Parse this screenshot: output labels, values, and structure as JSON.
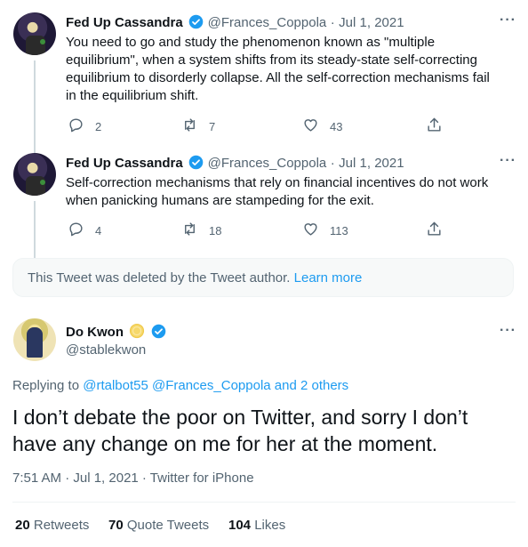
{
  "tweets": [
    {
      "name": "Fed Up Cassandra",
      "handle": "@Frances_Coppola",
      "date": "Jul 1, 2021",
      "text": "You need to go and study the phenomenon known as \"multiple equilibrium\", when a system shifts from its steady-state self-correcting equilibrium to disorderly collapse. All the self-correction mechanisms fail in the equilibrium shift.",
      "replies": "2",
      "retweets": "7",
      "likes": "43"
    },
    {
      "name": "Fed Up Cassandra",
      "handle": "@Frances_Coppola",
      "date": "Jul 1, 2021",
      "text": "Self-correction mechanisms that rely on financial incentives do not work when panicking humans are stampeding for the exit.",
      "replies": "4",
      "retweets": "18",
      "likes": "113"
    }
  ],
  "deleted_notice": {
    "text": "This Tweet was deleted by the Tweet author.",
    "link": "Learn more"
  },
  "main_tweet": {
    "name": "Do Kwon",
    "handle": "@stablekwon",
    "replying_label": "Replying to",
    "replying_to": "@rtalbot55 @Frances_Coppola and 2 others",
    "text": "I don’t debate the poor on Twitter, and sorry I don’t have any change on me for her at the moment.",
    "timestamp": "7:51 AM · Jul 1, 2021 · Twitter for iPhone",
    "stats": {
      "retweets_count": "20",
      "retweets_label": "Retweets",
      "quotes_count": "70",
      "quotes_label": "Quote Tweets",
      "likes_count": "104",
      "likes_label": "Likes"
    }
  },
  "colors": {
    "accent": "#1d9bf0",
    "muted": "#536471",
    "text": "#0f1419",
    "line": "#cfd9de"
  },
  "icons": [
    "verified-badge-icon",
    "reply-icon",
    "retweet-icon",
    "like-icon",
    "share-icon",
    "more-icon",
    "coin-emoji-icon"
  ]
}
